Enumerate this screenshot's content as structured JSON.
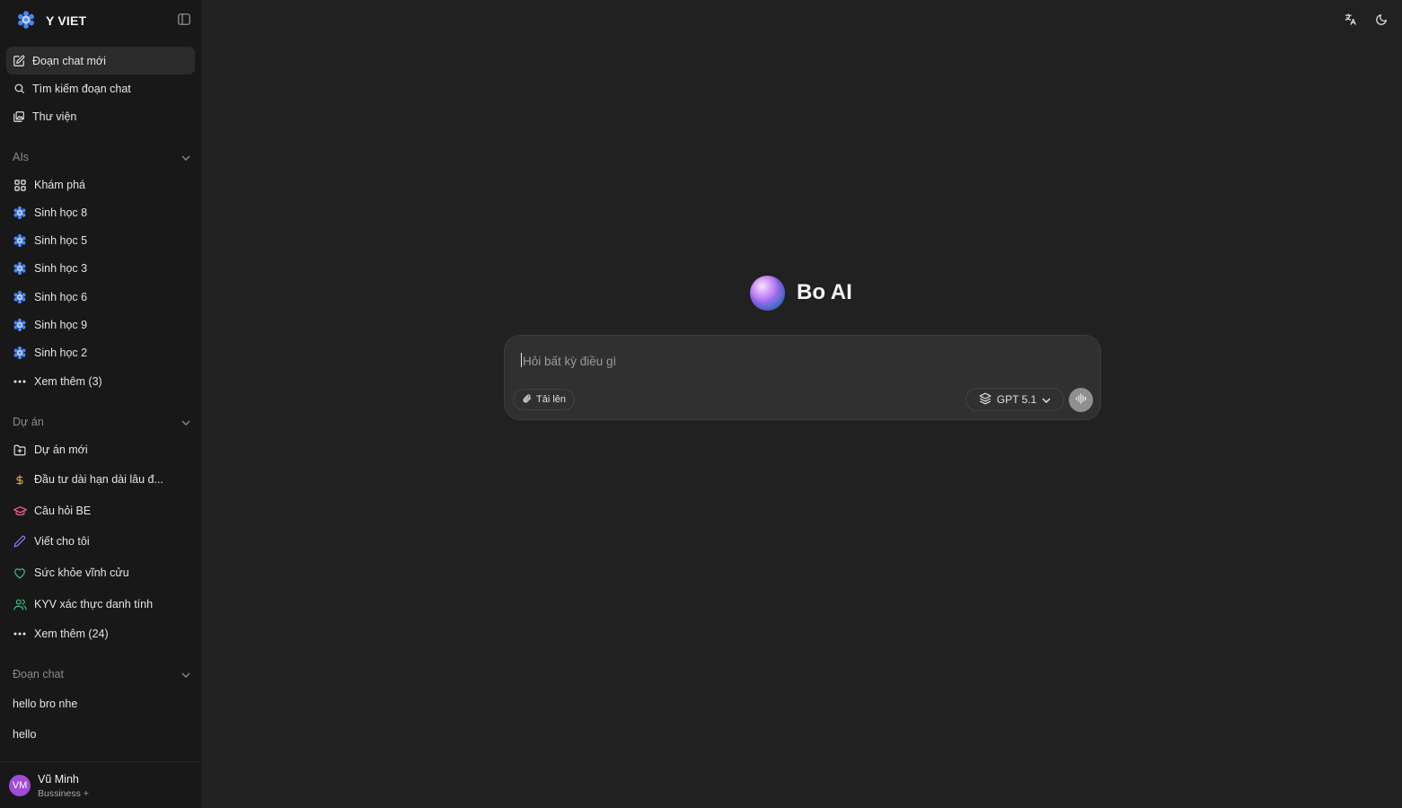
{
  "brand": {
    "name": "Y VIET"
  },
  "nav": [
    {
      "label": "Đoạn chat mới",
      "icon": "edit-icon"
    },
    {
      "label": "Tìm kiếm đoạn chat",
      "icon": "search-icon"
    },
    {
      "label": "Thư viện",
      "icon": "library-icon"
    }
  ],
  "ais": {
    "header": "AIs",
    "explore": "Khám phá",
    "items": [
      "Sinh học 8",
      "Sinh học 5",
      "Sinh học 3",
      "Sinh học 6",
      "Sinh học 9",
      "Sinh học 2"
    ],
    "more": "Xem thêm (3)"
  },
  "projects": {
    "header": "Dự án",
    "new": "Dự án mới",
    "items": [
      {
        "label": "Đầu tư dài hạn dài lâu đ...",
        "icon": "dollar-icon",
        "color": "#e8b14a"
      },
      {
        "label": "Câu hỏi BE",
        "icon": "graduation-cap-icon",
        "color": "#e25d8e"
      },
      {
        "label": "Viết cho tôi",
        "icon": "pen-icon",
        "color": "#9b7cf2"
      },
      {
        "label": "Sức khỏe vĩnh cửu",
        "icon": "heart-icon",
        "color": "#3fc38a"
      },
      {
        "label": "KYV xác thực danh tính",
        "icon": "users-icon",
        "color": "#3fc38a"
      }
    ],
    "more": "Xem thêm (24)"
  },
  "chats": {
    "header": "Đoạn chat",
    "items": [
      "hello bro nhe",
      "hello"
    ]
  },
  "profile": {
    "initials": "VM",
    "name": "Vũ Minh",
    "plan": "Bussiness +"
  },
  "hero": {
    "title": "Bo AI"
  },
  "composer": {
    "placeholder": "Hỏi bất kỳ điều gì",
    "upload_label": "Tải lên",
    "model": "GPT 5.1"
  },
  "colors": {
    "sidebar": "#181818",
    "main": "#212121",
    "composer": "#303030",
    "avatar": "#a14bd6",
    "ai_icon": "#4a86f0"
  }
}
